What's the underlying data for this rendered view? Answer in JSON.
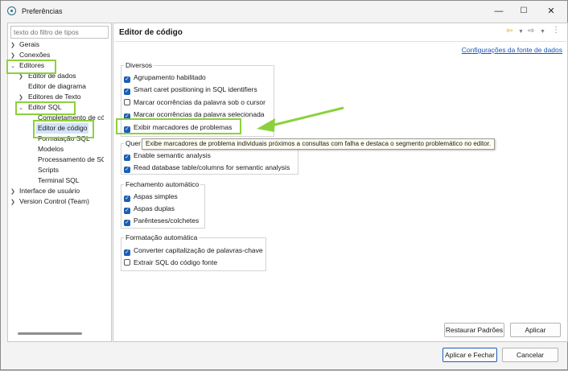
{
  "window": {
    "title": "Preferências"
  },
  "sidebar": {
    "filter_placeholder": "texto do filtro de tipos",
    "items": [
      {
        "label": "Gerais"
      },
      {
        "label": "Conexões"
      },
      {
        "label": "Editores"
      },
      {
        "label": "Editor de dados"
      },
      {
        "label": "Editor de diagrama"
      },
      {
        "label": "Editores de Texto"
      },
      {
        "label": "Editor SQL"
      },
      {
        "label": "Completamento de código"
      },
      {
        "label": "Editor de código"
      },
      {
        "label": "Formatação SQL"
      },
      {
        "label": "Modelos"
      },
      {
        "label": "Processamento de SQL"
      },
      {
        "label": "Scripts"
      },
      {
        "label": "Terminal SQL"
      },
      {
        "label": "Interface de usuário"
      },
      {
        "label": "Version Control (Team)"
      }
    ]
  },
  "page": {
    "title": "Editor de código",
    "link": "Configurações da fonte de dados",
    "groups": {
      "diversos": {
        "title": "Diversos",
        "items": [
          {
            "label": "Agrupamento habilitado",
            "checked": true
          },
          {
            "label": "Smart caret positioning in SQL identifiers",
            "checked": true
          },
          {
            "label": "Marcar ocorrências da palavra sob o cursor",
            "checked": false
          },
          {
            "label": "Marcar ocorrências da palavra selecionada",
            "checked": true
          },
          {
            "label": "Exibir marcadores de problemas",
            "checked": true
          }
        ]
      },
      "semantic": {
        "title": "Quer",
        "items": [
          {
            "label": "Enable semantic analysis",
            "checked": true
          },
          {
            "label": "Read database table/columns for semantic analysis",
            "checked": true
          }
        ]
      },
      "fechamento": {
        "title": "Fechamento automático",
        "items": [
          {
            "label": "Aspas simples",
            "checked": true
          },
          {
            "label": "Aspas duplas",
            "checked": true
          },
          {
            "label": "Parênteses/colchetes",
            "checked": true
          }
        ]
      },
      "formatacao": {
        "title": "Formatação automática",
        "items": [
          {
            "label": "Converter capitalização de palavras-chave",
            "checked": true
          },
          {
            "label": "Extrair SQL do código fonte",
            "checked": false
          }
        ]
      }
    },
    "tooltip": "Exibe marcadores de problema individuais próximos a consultas com falha e destaca o segmento problemático no editor."
  },
  "buttons": {
    "restore": "Restaurar Padrões",
    "apply": "Aplicar",
    "apply_close": "Aplicar e Fechar",
    "cancel": "Cancelar"
  },
  "colors": {
    "highlight": "#8cd13d",
    "checkbox": "#1a5fb4",
    "link": "#1b55b5"
  }
}
